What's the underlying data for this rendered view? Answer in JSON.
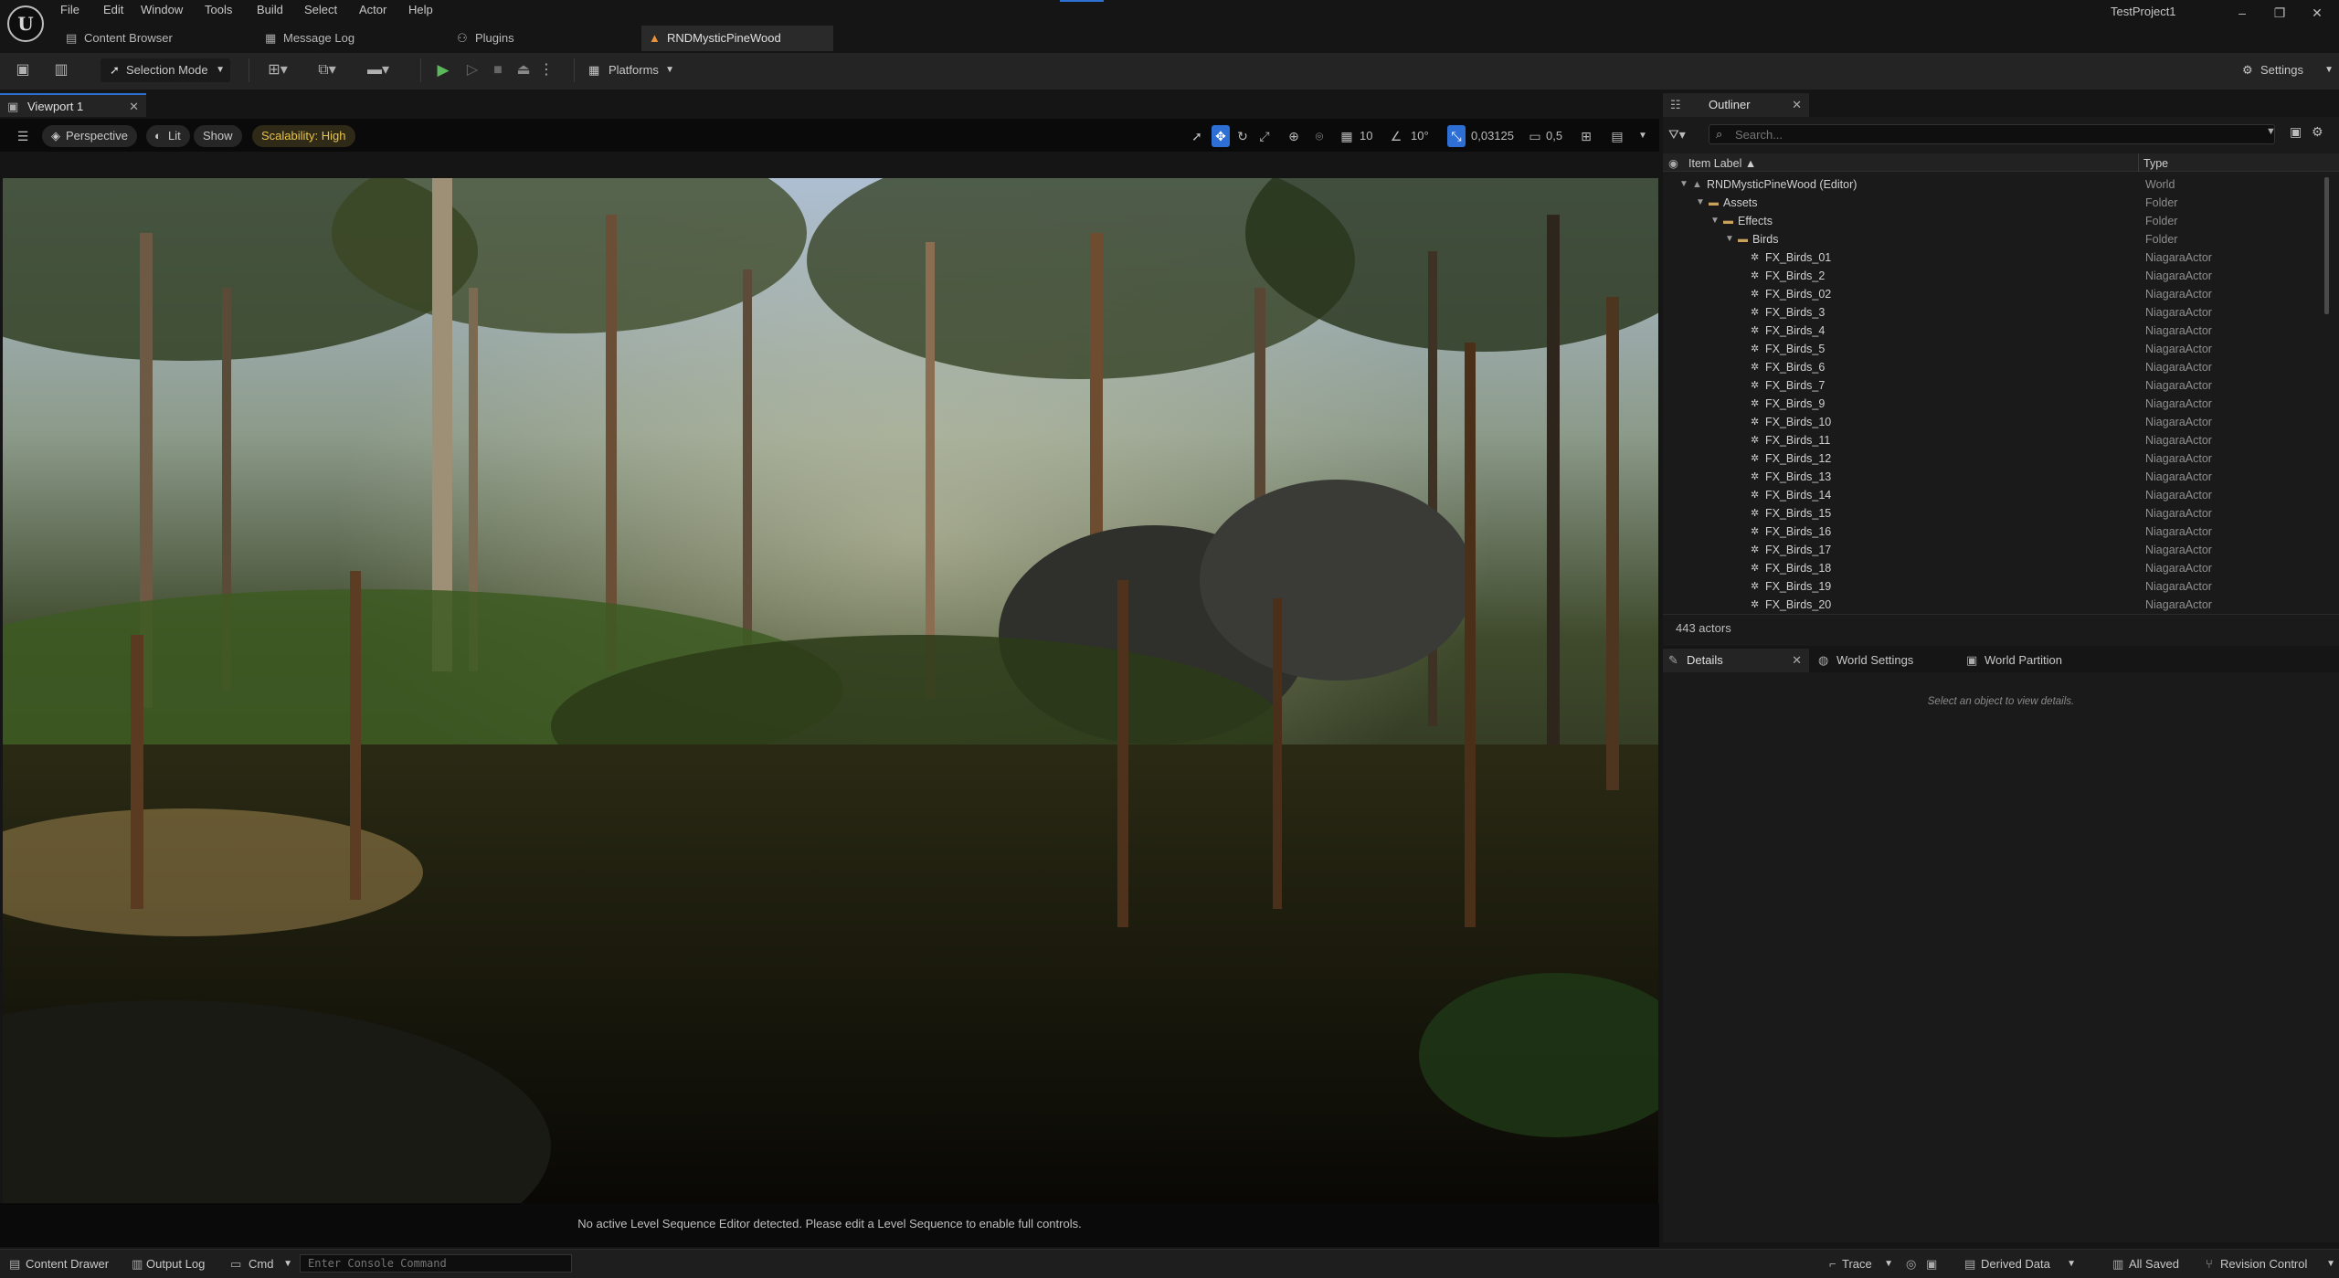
{
  "menu": [
    "File",
    "Edit",
    "Window",
    "Tools",
    "Build",
    "Select",
    "Actor",
    "Help"
  ],
  "project_name": "TestProject1",
  "tabs": {
    "content_browser": "Content Browser",
    "message_log": "Message Log",
    "plugins": "Plugins",
    "level": "RNDMysticPineWood"
  },
  "toolbar": {
    "selection_mode": "Selection Mode",
    "platforms": "Platforms",
    "settings": "Settings"
  },
  "viewport": {
    "tab_label": "Viewport 1",
    "perspective": "Perspective",
    "lit": "Lit",
    "show": "Show",
    "scalability": "Scalability: High",
    "grid_snap": "10",
    "rotation_snap": "10°",
    "scale_snap": "0,03125",
    "camera_speed": "0,5",
    "sequence_message": "No active Level Sequence Editor detected. Please edit a Level Sequence to enable full controls."
  },
  "outliner": {
    "tab_label": "Outliner",
    "search_placeholder": "Search...",
    "col_label": "Item Label ▲",
    "col_type": "Type",
    "actor_count": "443 actors",
    "rows": [
      {
        "label": "RNDMysticPineWood (Editor)",
        "type": "World"
      },
      {
        "label": "Assets",
        "type": "Folder"
      },
      {
        "label": "Effects",
        "type": "Folder"
      },
      {
        "label": "Birds",
        "type": "Folder"
      },
      {
        "label": "FX_Birds_01",
        "type": "NiagaraActor"
      },
      {
        "label": "FX_Birds_2",
        "type": "NiagaraActor"
      },
      {
        "label": "FX_Birds_02",
        "type": "NiagaraActor"
      },
      {
        "label": "FX_Birds_3",
        "type": "NiagaraActor"
      },
      {
        "label": "FX_Birds_4",
        "type": "NiagaraActor"
      },
      {
        "label": "FX_Birds_5",
        "type": "NiagaraActor"
      },
      {
        "label": "FX_Birds_6",
        "type": "NiagaraActor"
      },
      {
        "label": "FX_Birds_7",
        "type": "NiagaraActor"
      },
      {
        "label": "FX_Birds_9",
        "type": "NiagaraActor"
      },
      {
        "label": "FX_Birds_10",
        "type": "NiagaraActor"
      },
      {
        "label": "FX_Birds_11",
        "type": "NiagaraActor"
      },
      {
        "label": "FX_Birds_12",
        "type": "NiagaraActor"
      },
      {
        "label": "FX_Birds_13",
        "type": "NiagaraActor"
      },
      {
        "label": "FX_Birds_14",
        "type": "NiagaraActor"
      },
      {
        "label": "FX_Birds_15",
        "type": "NiagaraActor"
      },
      {
        "label": "FX_Birds_16",
        "type": "NiagaraActor"
      },
      {
        "label": "FX_Birds_17",
        "type": "NiagaraActor"
      },
      {
        "label": "FX_Birds_18",
        "type": "NiagaraActor"
      },
      {
        "label": "FX_Birds_19",
        "type": "NiagaraActor"
      },
      {
        "label": "FX_Birds_20",
        "type": "NiagaraActor"
      }
    ]
  },
  "details": {
    "tab_details": "Details",
    "tab_world_settings": "World Settings",
    "tab_world_partition": "World Partition",
    "empty_message": "Select an object to view details."
  },
  "statusbar": {
    "content_drawer": "Content Drawer",
    "output_log": "Output Log",
    "cmd": "Cmd",
    "console_placeholder": "Enter Console Command",
    "trace": "Trace",
    "derived_data": "Derived Data",
    "all_saved": "All Saved",
    "revision_control": "Revision Control"
  },
  "colors": {
    "accent": "#2e6fd6",
    "play_green": "#5bb85b",
    "scalability_text": "#e8c34a",
    "folder": "#c9a25a",
    "world_icon": "#9a9a9a"
  }
}
